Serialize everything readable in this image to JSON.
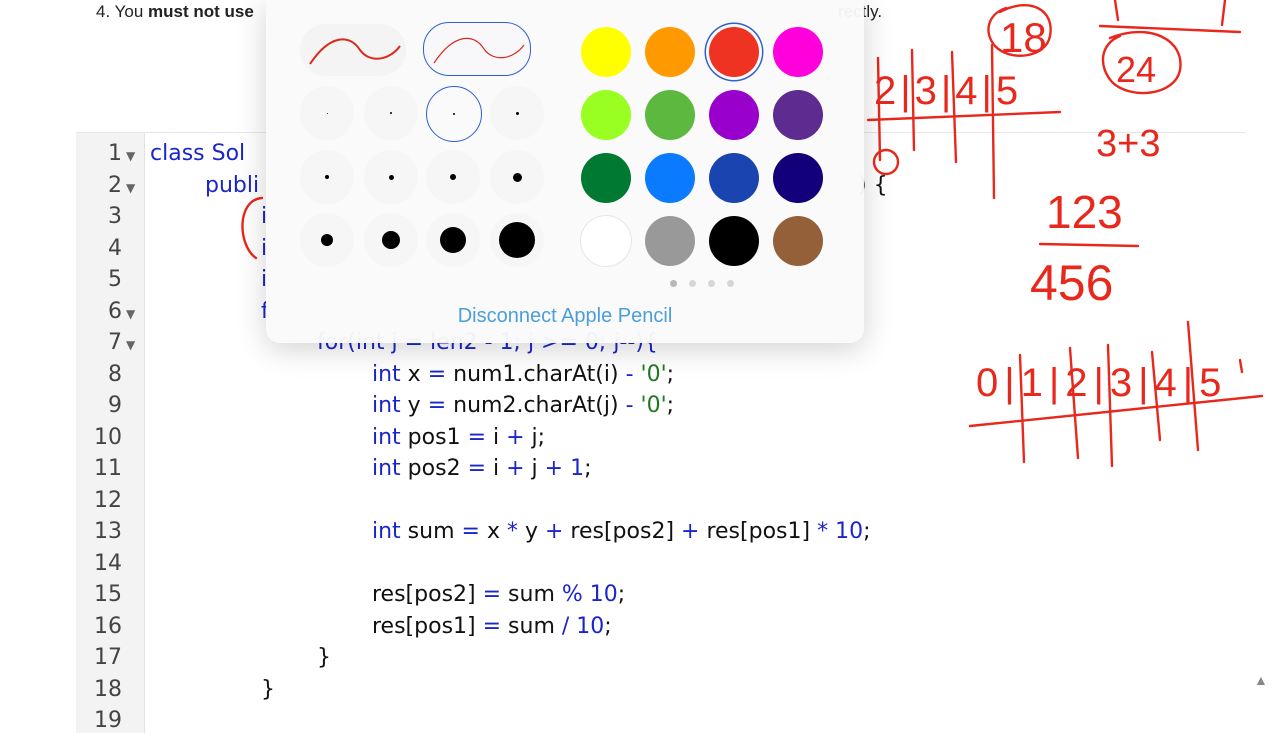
{
  "instruction": {
    "prefix": "4. You ",
    "bold": "must not use",
    "tail": "rectly."
  },
  "editor": {
    "line_numbers": [
      "1",
      "2",
      "3",
      "4",
      "5",
      "6",
      "7",
      "8",
      "9",
      "10",
      "11",
      "12",
      "13",
      "14",
      "15",
      "16",
      "17",
      "18",
      "19"
    ],
    "fold_lines": [
      "1",
      "2",
      "6",
      "7"
    ],
    "code": {
      "l1a": "class Sol",
      "l2a": "publi",
      "l2b": ") {",
      "l3a": "i",
      "l4a": "i",
      "l5a": "i",
      "l6a": "f",
      "l7a": "for(int j = len2 - 1; j >= 0; j--){",
      "l8_kw": "int",
      "l8_var": " x ",
      "l8_op": "=",
      "l8_expr": " num1.charAt(i) ",
      "l8_minus": "-",
      "l8_str": " '0'",
      "l8_end": ";",
      "l9_kw": "int",
      "l9_var": " y ",
      "l9_op": "=",
      "l9_expr": " num2.charAt(j) ",
      "l9_minus": "-",
      "l9_str": " '0'",
      "l9_end": ";",
      "l10_kw": "int",
      "l10_var": " pos1 ",
      "l10_op": "=",
      "l10_i": " i ",
      "l10_plus": "+",
      "l10_end": " j;",
      "l11_kw": "int",
      "l11_var": " pos2 ",
      "l11_op": "=",
      "l11_i": " i ",
      "l11_plus1": "+",
      "l11_j": " j ",
      "l11_plus2": "+",
      "l11_num": " 1",
      "l11_end": ";",
      "l13_kw": "int",
      "l13_var": " sum ",
      "l13_op": "=",
      "l13_x": " x ",
      "l13_mul": "*",
      "l13_y": " y ",
      "l13_plus": "+",
      "l13_a": " res[pos2] ",
      "l13_plus2": "+",
      "l13_b": " res[pos1] ",
      "l13_mul2": "*",
      "l13_num": " 10",
      "l13_end": ";",
      "l15_a": "res[pos2] ",
      "l15_op": "=",
      "l15_b": " sum ",
      "l15_mod": "%",
      "l15_num": " 10",
      "l15_end": ";",
      "l16_a": "res[pos1] ",
      "l16_op": "=",
      "l16_b": " sum ",
      "l16_div": "/",
      "l16_num": " 10",
      "l16_end": ";",
      "l17": "}",
      "l18": "}"
    }
  },
  "palette": {
    "disconnect_label": "Disconnect Apple Pencil",
    "colors": [
      "#ffff00",
      "#ff9900",
      "#ee3322",
      "#ff00dd",
      "#99ff22",
      "#5cb83e",
      "#9900cc",
      "#5e2b91",
      "#007a33",
      "#0a7aff",
      "#1a44b0",
      "#11007a",
      "#ffffff",
      "#999999",
      "#000000",
      "#94603a"
    ],
    "selected_color": "#ee3322",
    "ink_color": "#e8281c"
  },
  "annotations": {
    "n18": "18",
    "n24": "24",
    "n33": "3+3",
    "n123": "123",
    "n456": "456",
    "row_top": "2|3|4|5",
    "row_bottom": "0|1|2|3|4|5"
  }
}
